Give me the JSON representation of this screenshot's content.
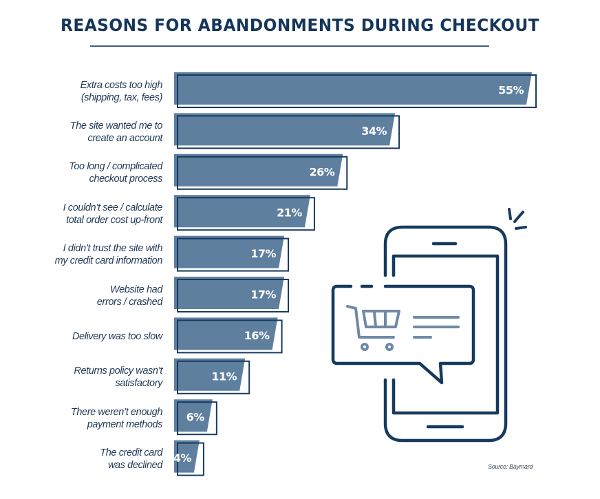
{
  "chart_data": {
    "type": "bar",
    "orientation": "horizontal",
    "title": "REASONS FOR ABANDONMENTS DURING CHECKOUT",
    "xlabel": "",
    "ylabel": "",
    "grid": false,
    "xlim": [
      0,
      55
    ],
    "categories": [
      [
        "Extra costs too high",
        "(shipping, tax, fees)"
      ],
      [
        "The site wanted me to",
        "create an account"
      ],
      [
        "Too long / complicated",
        "checkout process"
      ],
      [
        "I couldn’t see / calculate",
        "total order cost up-front"
      ],
      [
        "I didn’t trust the site with",
        "my credit card information"
      ],
      [
        "Website had",
        "errors / crashed"
      ],
      [
        "Delivery was too slow"
      ],
      [
        "Returns policy wasn’t",
        "satisfactory"
      ],
      [
        "There weren’t enough",
        "payment methods"
      ],
      [
        "The credit card",
        "was declined"
      ]
    ],
    "values": [
      55,
      34,
      26,
      21,
      17,
      17,
      16,
      11,
      6,
      4
    ],
    "data_labels": [
      "55%",
      "34%",
      "26%",
      "21%",
      "17%",
      "17%",
      "16%",
      "11%",
      "6%",
      "4%"
    ],
    "unit": "%",
    "source": "Source: Baymard"
  },
  "colors": {
    "title": "#15365a",
    "bar_fill": "#5f7f9f",
    "bar_outline": "#163a5e",
    "label_text": "#233b5a",
    "data_label": "#ffffff",
    "illustration_stroke": "#163a5e",
    "cart_stroke": "#6f8aa6"
  },
  "illustration": {
    "icons": [
      "smartphone-icon",
      "chat-bubble-icon",
      "shopping-cart-icon",
      "notification-burst-icon"
    ]
  }
}
